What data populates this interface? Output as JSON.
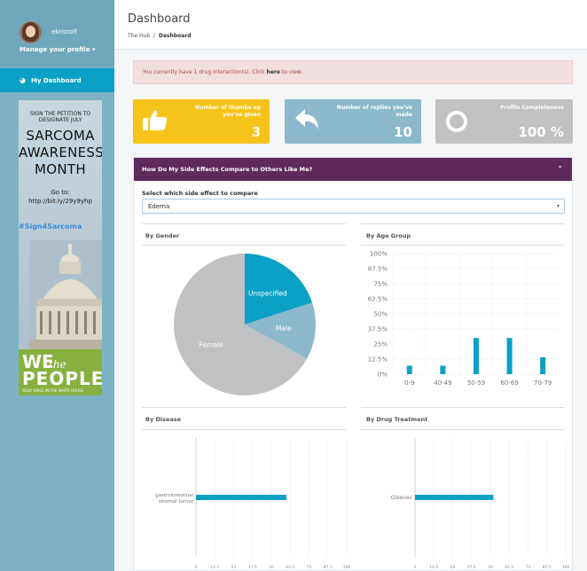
{
  "sidebar": {
    "username": "ekristoff",
    "manage_profile": "Manage your profile",
    "nav_dashboard": "My Dashboard",
    "ad": {
      "line1": "SIGN THE PETITION TO",
      "line2": "DESIGNATE JULY",
      "headline1": "SARCOMA",
      "headline2": "AWARENESS",
      "headline3": "MONTH",
      "goto": "Go to:",
      "url": "http://bit.ly/29y9yhp",
      "hashtag": "#Sign4Sarcoma",
      "we": "WE",
      "the": "the",
      "people": "PEOPLE",
      "tagline": "YOUR VOICE IN THE WHITE HOUSE"
    }
  },
  "header": {
    "title": "Dashboard",
    "breadcrumb_root": "The Hub",
    "breadcrumb_sep": "/",
    "breadcrumb_current": "Dashboard"
  },
  "alert": {
    "before": "You currently have 1 drug interaction(s). Click",
    "link": "here",
    "after": "to view."
  },
  "tiles": {
    "thumbs_label": "Number of thumbs up you've given",
    "thumbs_value": "3",
    "replies_label": "Number of replies you've made",
    "replies_value": "10",
    "profile_label": "Profile Completeness",
    "profile_value": "100 %"
  },
  "panel": {
    "title": "How Do My Side Effects Compare to Others Like Me?",
    "select_label": "Select which side effect to compare",
    "selected": "Edema",
    "by_gender": "By Gender",
    "by_age": "By Age Group",
    "by_disease": "By Disease",
    "by_drug": "By Drug Treatment"
  },
  "colors": {
    "accent": "#0ba1c6",
    "purple": "#5e2a5c",
    "yellow": "#f6c31b",
    "gray": "#bfc1c2",
    "lightblue": "#8bb9cb"
  },
  "chart_data": [
    {
      "type": "pie",
      "categories": [
        "Unspecified",
        "Male",
        "Female"
      ],
      "values": [
        20,
        13,
        67
      ],
      "colors": [
        "#0ba1c6",
        "#8bb9cb",
        "#bfc1c2"
      ]
    },
    {
      "type": "bar",
      "categories": [
        "0-9",
        "40-49",
        "50-59",
        "60-69",
        "70-79"
      ],
      "values": [
        7,
        7,
        30,
        30,
        14
      ],
      "ylim": [
        0,
        100
      ],
      "yticks": [
        "0%",
        "12.5%",
        "25%",
        "37.5%",
        "50%",
        "62.5%",
        "75%",
        "87.5%",
        "100%"
      ]
    },
    {
      "type": "bar",
      "orientation": "horizontal",
      "categories": [
        "gastrointestinal stromal tumor"
      ],
      "values": [
        60
      ],
      "xlim": [
        0,
        100
      ],
      "xticks": [
        "0",
        "12.5",
        "25",
        "37.5",
        "50",
        "62.5",
        "75",
        "87.5",
        "100"
      ]
    },
    {
      "type": "bar",
      "orientation": "horizontal",
      "categories": [
        "Gleevec"
      ],
      "values": [
        52
      ],
      "xlim": [
        0,
        100
      ],
      "xticks": [
        "0",
        "12.5",
        "25",
        "37.5",
        "50",
        "62.5",
        "75",
        "87.5",
        "100"
      ]
    }
  ]
}
